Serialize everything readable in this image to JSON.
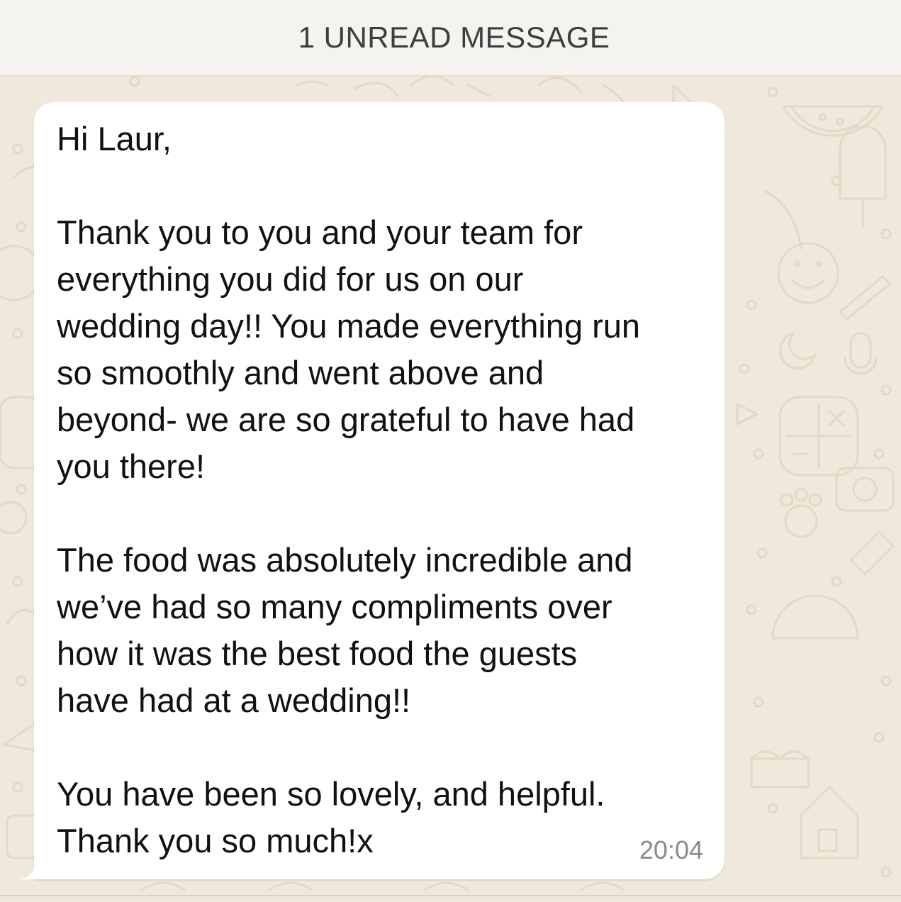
{
  "banner": {
    "unread_label": "1 UNREAD MESSAGE"
  },
  "message": {
    "lines": [
      "Hi Laur,",
      "",
      "Thank you to you and your team for",
      "everything you did for us on our",
      "wedding day!! You made everything run",
      "so smoothly and went above and",
      "beyond- we are so grateful to have had",
      "you there!",
      "",
      "The food was absolutely incredible and",
      "we’ve had so many compliments over",
      "how it was the best food the guests",
      "have had at a wedding!!",
      "",
      "You have been so lovely, and helpful.",
      "Thank you so much!x"
    ],
    "time": "20:04"
  },
  "colors": {
    "wallpaper": "#efe9dc",
    "doodle": "#e2d9c6",
    "bubble": "#ffffff",
    "banner": "#f5f3ef",
    "timestamp": "#8a8a8a"
  },
  "icons": [
    "calendar-doodle-icon",
    "smiley-doodle-icon",
    "calculator-doodle-icon",
    "watermelon-doodle-icon",
    "popsicle-doodle-icon",
    "paw-doodle-icon"
  ]
}
